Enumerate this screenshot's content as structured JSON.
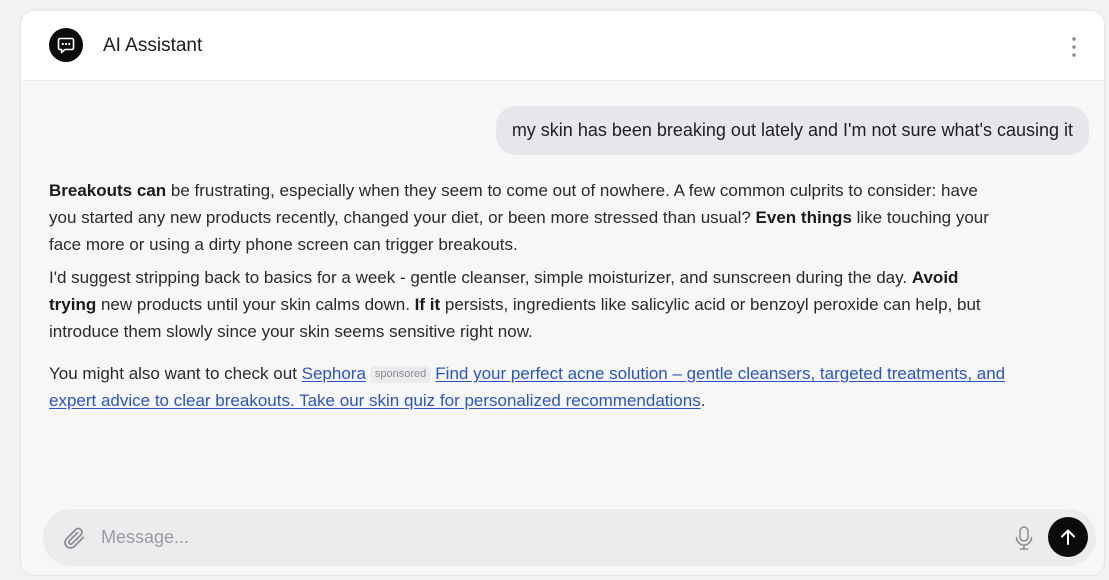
{
  "header": {
    "title": "AI Assistant"
  },
  "conversation": {
    "user_message": "my skin has been breaking out lately and I'm not sure what's causing it",
    "assistant": {
      "p1": {
        "b1": "Breakouts can",
        "t1": " be frustrating, especially when they seem to come out of nowhere. A few common culprits to consider: have you started any new products recently, changed your diet, or been more stressed than usual? ",
        "b2": "Even things",
        "t2": " like touching your face more or using a dirty phone screen can trigger breakouts."
      },
      "p2": {
        "t1": "I'd suggest stripping back to basics for a week - gentle cleanser, simple moisturizer, and sunscreen during the day. ",
        "b1": "Avoid trying",
        "t2": " new products until your skin calms down. ",
        "b2": "If it",
        "t3": " persists, ingredients like salicylic acid or benzoyl peroxide can help, but introduce them slowly since your skin seems sensitive right now."
      },
      "ad": {
        "lead": "You might also want to check out ",
        "brand": "Sephora",
        "badge": "sponsored",
        "link_text": "Find your perfect acne solution – gentle cleansers, targeted treatments, and expert advice to clear breakouts. Take our skin quiz for personalized recommendations",
        "tail": "."
      }
    }
  },
  "composer": {
    "placeholder": "Message...",
    "value": ""
  },
  "icons": {
    "avatar": "chat-bubble-icon",
    "menu": "more-vertical-icon",
    "attach": "paperclip-icon",
    "mic": "microphone-icon",
    "send": "arrow-up-icon"
  },
  "colors": {
    "link": "#2a55c8",
    "send_button": "#0b0b0c",
    "user_bubble": "#e6e7ea"
  }
}
